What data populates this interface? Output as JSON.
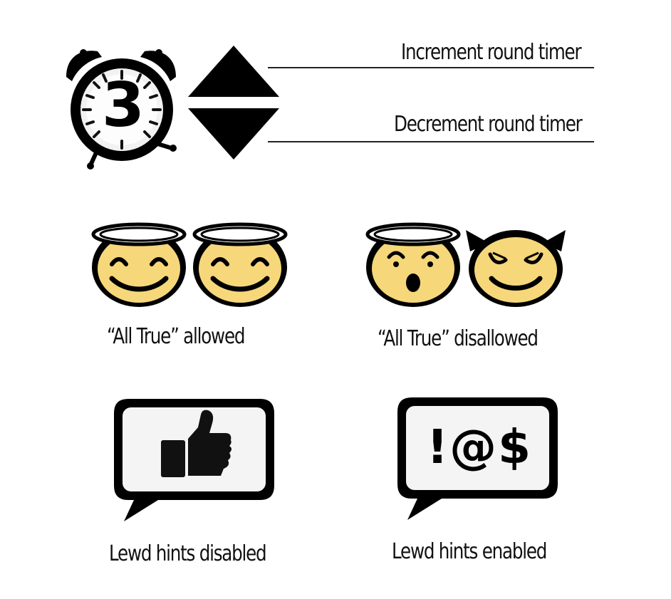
{
  "timer": {
    "digit": "3",
    "increment_label": "Increment round timer",
    "decrement_label": "Decrement round timer"
  },
  "all_true": {
    "allowed_label": "“All True” allowed",
    "disallowed_label": "“All True” disallowed"
  },
  "lewd_hints": {
    "disabled_label": "Lewd hints disabled",
    "enabled_label": "Lewd hints enabled",
    "symbols": "!@$"
  },
  "colors": {
    "face_fill": "#f6d77a",
    "outline": "#000000"
  },
  "icons": [
    "alarm-clock-icon",
    "increment-arrow-icon",
    "decrement-arrow-icon",
    "angel-emoji-icon",
    "surprised-angel-emoji-icon",
    "devil-emoji-icon",
    "speech-bubble-thumbs-up-icon",
    "speech-bubble-symbols-icon"
  ]
}
